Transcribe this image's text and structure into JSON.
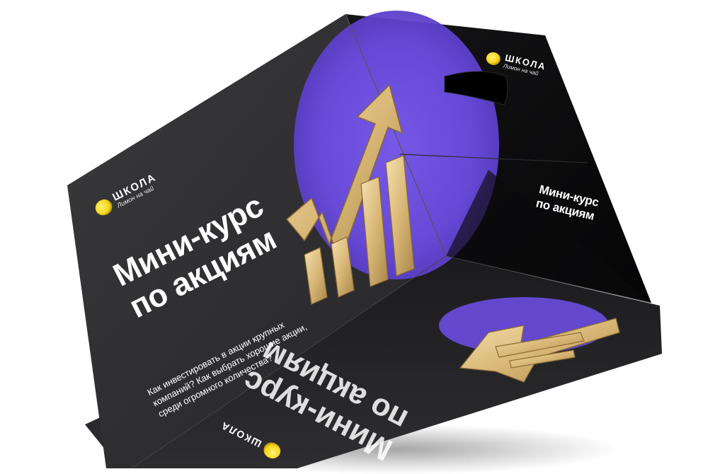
{
  "box": {
    "left_face": {
      "logo_title": "ШКОЛА",
      "logo_subtitle": "Лимон на чай",
      "title_line1": "Мини-курс",
      "title_line2": "по акциям",
      "description": "Как инвестировать в акции крупных компаний? Как выбрать хорошие акции, среди огромного количества?"
    },
    "right_face": {
      "logo_title": "ШКОЛА",
      "logo_subtitle": "Лимон на чай",
      "title_line1": "Мини-курс",
      "title_line2": "по акциям"
    },
    "bottom_face": {
      "logo_title": "ШКОЛА",
      "title_line1": "Мини-курс",
      "title_line2": "по акциям"
    }
  },
  "colors": {
    "box_dark": "#2b2b2e",
    "box_black": "#0e0e10",
    "accent_purple": "#6a4ce0",
    "gold": "#d9b877",
    "logo_yellow": "#f6d313"
  },
  "graphics": {
    "arrow": "gold-growth-arrow-icon",
    "bars": "gold-bar-chart-icon",
    "coin": "lemon-coin-logo-icon"
  }
}
